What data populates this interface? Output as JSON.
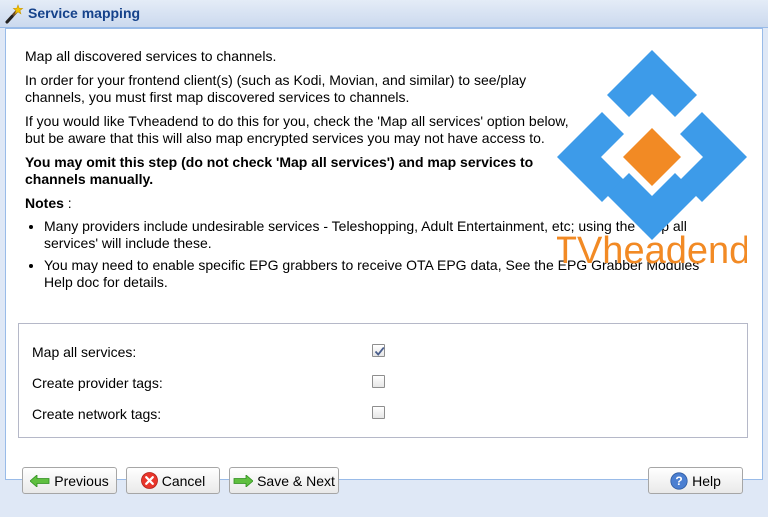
{
  "window": {
    "title": "Service mapping"
  },
  "intro": {
    "line1": "Map all discovered services to channels.",
    "line2": "In order for your frontend client(s) (such as Kodi, Movian, and similar) to see/play channels, you must first map discovered services to channels.",
    "line3": "If you would like Tvheadend to do this for you, check the 'Map all services' option below, but be aware that this will also map encrypted services you may not have access to.",
    "line4": "You may omit this step (do not check 'Map all services') and map services to channels manually."
  },
  "notes": {
    "label": "Notes",
    "suffix": " :",
    "items": [
      "Many providers include undesirable services - Teleshopping, Adult Entertainment, etc; using the 'Map all services' will include these.",
      "You may need to enable specific EPG grabbers to receive OTA EPG data, See the EPG Grabber Modules Help doc for details."
    ]
  },
  "logo": {
    "text": "TVheadend"
  },
  "options": [
    {
      "label": "Map all services:",
      "checked": true
    },
    {
      "label": "Create provider tags:",
      "checked": false
    },
    {
      "label": "Create network tags:",
      "checked": false
    }
  ],
  "buttons": {
    "previous": "Previous",
    "cancel": "Cancel",
    "save_next": "Save & Next",
    "help": "Help"
  },
  "icons": {
    "title": "magic-wand-icon",
    "previous": "arrow-left-icon",
    "cancel": "cancel-icon",
    "save_next": "arrow-right-icon",
    "help": "help-icon"
  },
  "colors": {
    "title_text": "#15428b",
    "logo_blue": "#3d9be9",
    "logo_orange": "#f28a24"
  }
}
